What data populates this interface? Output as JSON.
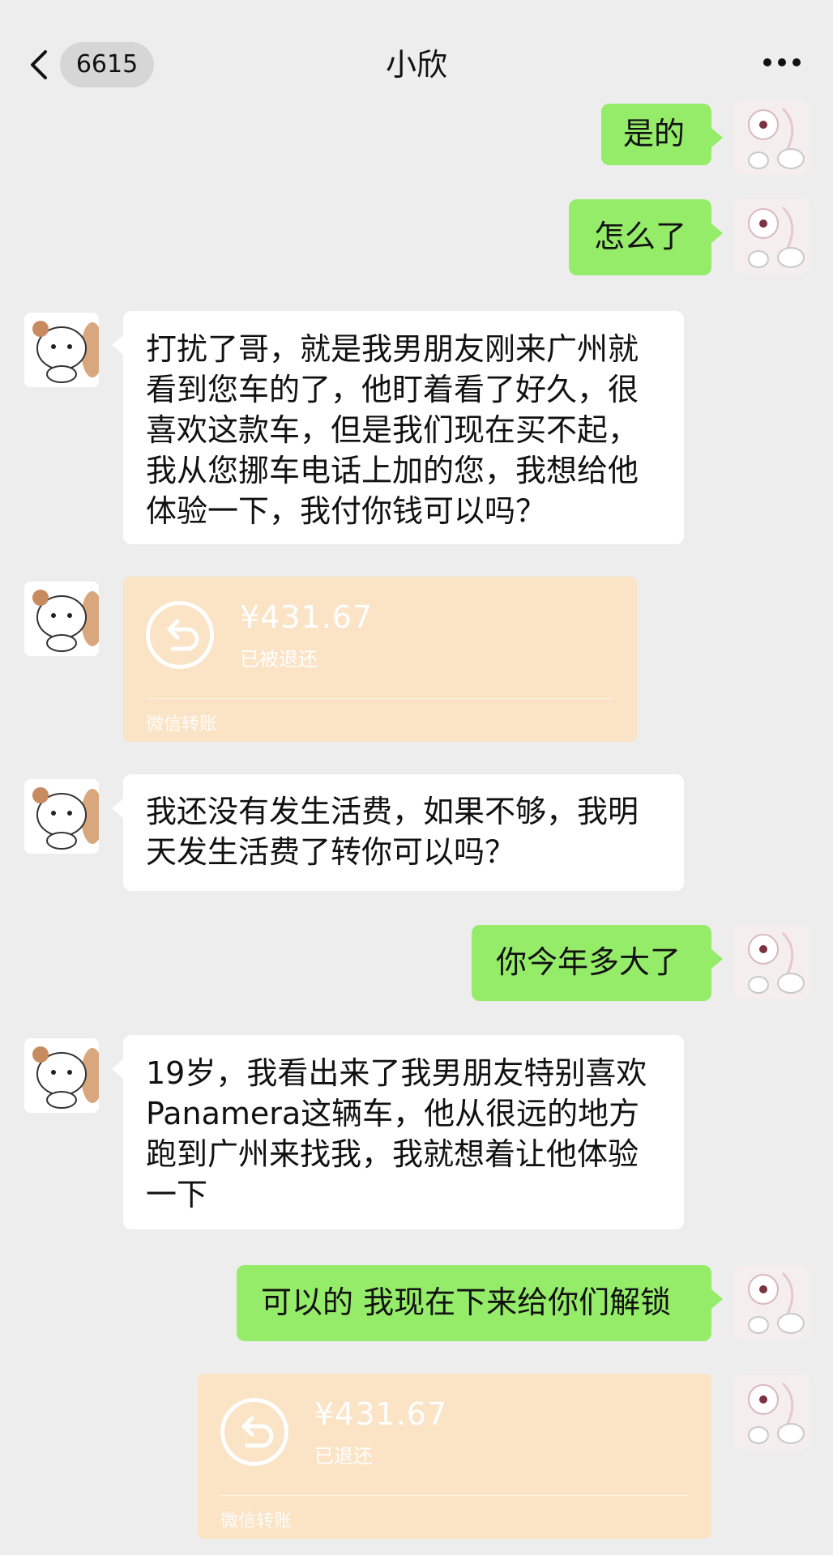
{
  "header": {
    "unread_count": "6615",
    "title": "小欣"
  },
  "messages": [
    {
      "id": 1,
      "side": "right",
      "type": "text",
      "text": "是的"
    },
    {
      "id": 2,
      "side": "right",
      "type": "text",
      "text": "怎么了"
    },
    {
      "id": 3,
      "side": "left",
      "type": "text",
      "lines": [
        "打扰了哥，就是我男朋友刚来广州就",
        "看到您车的了，他盯着看了好久，很",
        "喜欢这款车，但是我们现在买不起，",
        "我从您挪车电话上加的您，我想给他",
        "体验一下，我付你钱可以吗？"
      ]
    },
    {
      "id": 4,
      "side": "left",
      "type": "transfer",
      "amount": "¥431.67",
      "status": "已被退还",
      "footer": "微信转账"
    },
    {
      "id": 5,
      "side": "left",
      "type": "text",
      "lines": [
        "我还没有发生活费，如果不够，我明",
        "天发生活费了转你可以吗？"
      ]
    },
    {
      "id": 6,
      "side": "right",
      "type": "text",
      "text": "你今年多大了"
    },
    {
      "id": 7,
      "side": "left",
      "type": "text",
      "lines": [
        "19岁，我看出来了我男朋友特别喜欢",
        "Panamera这辆车，他从很远的地方",
        "跑到广州来找我，我就想着让他体验",
        "一下"
      ]
    },
    {
      "id": 8,
      "side": "right",
      "type": "text",
      "text": "可以的 我现在下来给你们解锁"
    },
    {
      "id": 9,
      "side": "right",
      "type": "transfer",
      "amount": "¥431.67",
      "status": "已退还",
      "footer": "微信转账"
    }
  ],
  "colors": {
    "background": "#ededed",
    "my_bubble": "#95ec69",
    "their_bubble": "#ffffff",
    "transfer_card": "#fbe3c6"
  },
  "icons": [
    "chevron-left-icon",
    "more-icon",
    "return-arrow-icon"
  ]
}
